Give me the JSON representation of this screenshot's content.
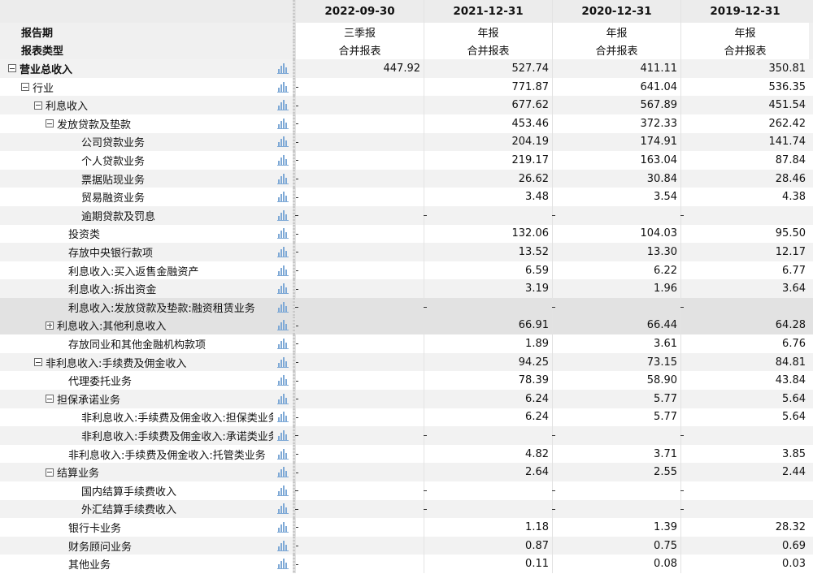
{
  "header": {
    "periods": [
      "2022-09-30",
      "2021-12-31",
      "2020-12-31",
      "2019-12-31"
    ],
    "report_period_label": "报告期",
    "report_type_label": "报表类型",
    "report_periods": [
      "三季报",
      "年报",
      "年报",
      "年报"
    ],
    "report_types": [
      "合并报表",
      "合并报表",
      "合并报表",
      "合并报表"
    ]
  },
  "rows": [
    {
      "label": "营业总收入",
      "indent": 0,
      "toggle": "minus",
      "bold": true,
      "values": [
        "447.92",
        "527.74",
        "411.11",
        "350.81"
      ],
      "dashes": [
        false,
        false,
        false,
        false,
        false
      ]
    },
    {
      "label": "行业",
      "indent": 1,
      "toggle": "minus",
      "values": [
        "",
        "771.87",
        "641.04",
        "536.35"
      ],
      "dashes": [
        true,
        false,
        false,
        false,
        false
      ]
    },
    {
      "label": "利息收入",
      "indent": 2,
      "toggle": "minus",
      "values": [
        "",
        "677.62",
        "567.89",
        "451.54"
      ],
      "dashes": [
        true,
        false,
        false,
        false,
        false
      ]
    },
    {
      "label": "发放贷款及垫款",
      "indent": 3,
      "toggle": "minus",
      "values": [
        "",
        "453.46",
        "372.33",
        "262.42"
      ],
      "dashes": [
        true,
        false,
        false,
        false,
        false
      ]
    },
    {
      "label": "公司贷款业务",
      "indent": 5,
      "values": [
        "",
        "204.19",
        "174.91",
        "141.74"
      ],
      "dashes": [
        true,
        false,
        false,
        false,
        false
      ]
    },
    {
      "label": "个人贷款业务",
      "indent": 5,
      "values": [
        "",
        "219.17",
        "163.04",
        "87.84"
      ],
      "dashes": [
        true,
        false,
        false,
        false,
        false
      ]
    },
    {
      "label": "票据贴现业务",
      "indent": 5,
      "values": [
        "",
        "26.62",
        "30.84",
        "28.46"
      ],
      "dashes": [
        true,
        false,
        false,
        false,
        false
      ]
    },
    {
      "label": "贸易融资业务",
      "indent": 5,
      "values": [
        "",
        "3.48",
        "3.54",
        "4.38"
      ],
      "dashes": [
        true,
        false,
        false,
        false,
        false
      ]
    },
    {
      "label": "逾期贷款及罚息",
      "indent": 5,
      "values": [
        "",
        "",
        "",
        ""
      ],
      "dashes": [
        true,
        true,
        true,
        true,
        true
      ]
    },
    {
      "label": "投资类",
      "indent": 4,
      "values": [
        "",
        "132.06",
        "104.03",
        "95.50"
      ],
      "dashes": [
        true,
        false,
        false,
        false,
        false
      ]
    },
    {
      "label": "存放中央银行款项",
      "indent": 4,
      "values": [
        "",
        "13.52",
        "13.30",
        "12.17"
      ],
      "dashes": [
        true,
        false,
        false,
        false,
        false
      ]
    },
    {
      "label": "利息收入:买入返售金融资产",
      "indent": 4,
      "values": [
        "",
        "6.59",
        "6.22",
        "6.77"
      ],
      "dashes": [
        true,
        false,
        false,
        false,
        false
      ]
    },
    {
      "label": "利息收入:拆出资金",
      "indent": 4,
      "values": [
        "",
        "3.19",
        "1.96",
        "3.64"
      ],
      "dashes": [
        true,
        false,
        false,
        false,
        false
      ]
    },
    {
      "label": "利息收入:发放贷款及垫款:融资租赁业务",
      "indent": 4,
      "values": [
        "",
        "",
        "",
        ""
      ],
      "dashes": [
        true,
        true,
        true,
        true,
        true
      ],
      "dim": true
    },
    {
      "label": "利息收入:其他利息收入",
      "indent": 3,
      "toggle": "plus",
      "values": [
        "",
        "66.91",
        "66.44",
        "64.28"
      ],
      "dashes": [
        true,
        false,
        false,
        false,
        false
      ],
      "dim": true
    },
    {
      "label": "存放同业和其他金融机构款项",
      "indent": 4,
      "values": [
        "",
        "1.89",
        "3.61",
        "6.76"
      ],
      "dashes": [
        true,
        false,
        false,
        false,
        false
      ]
    },
    {
      "label": "非利息收入:手续费及佣金收入",
      "indent": 2,
      "toggle": "minus",
      "values": [
        "",
        "94.25",
        "73.15",
        "84.81"
      ],
      "dashes": [
        true,
        false,
        false,
        false,
        false
      ]
    },
    {
      "label": "代理委托业务",
      "indent": 4,
      "values": [
        "",
        "78.39",
        "58.90",
        "43.84"
      ],
      "dashes": [
        true,
        false,
        false,
        false,
        false
      ]
    },
    {
      "label": "担保承诺业务",
      "indent": 3,
      "toggle": "minus",
      "values": [
        "",
        "6.24",
        "5.77",
        "5.64"
      ],
      "dashes": [
        true,
        false,
        false,
        false,
        false
      ]
    },
    {
      "label": "非利息收入:手续费及佣金收入:担保类业务",
      "indent": 5,
      "values": [
        "",
        "6.24",
        "5.77",
        "5.64"
      ],
      "dashes": [
        true,
        false,
        false,
        false,
        false
      ]
    },
    {
      "label": "非利息收入:手续费及佣金收入:承诺类业务",
      "indent": 5,
      "values": [
        "",
        "",
        "",
        ""
      ],
      "dashes": [
        true,
        true,
        true,
        true,
        true
      ]
    },
    {
      "label": "非利息收入:手续费及佣金收入:托管类业务",
      "indent": 4,
      "values": [
        "",
        "4.82",
        "3.71",
        "3.85"
      ],
      "dashes": [
        true,
        false,
        false,
        false,
        false
      ]
    },
    {
      "label": "结算业务",
      "indent": 3,
      "toggle": "minus",
      "values": [
        "",
        "2.64",
        "2.55",
        "2.44"
      ],
      "dashes": [
        true,
        false,
        false,
        false,
        false
      ]
    },
    {
      "label": "国内结算手续费收入",
      "indent": 5,
      "values": [
        "",
        "",
        "",
        ""
      ],
      "dashes": [
        true,
        true,
        true,
        true,
        true
      ]
    },
    {
      "label": "外汇结算手续费收入",
      "indent": 5,
      "values": [
        "",
        "",
        "",
        ""
      ],
      "dashes": [
        true,
        true,
        true,
        true,
        true
      ]
    },
    {
      "label": "银行卡业务",
      "indent": 4,
      "values": [
        "",
        "1.18",
        "1.39",
        "28.32"
      ],
      "dashes": [
        true,
        false,
        false,
        false,
        false
      ]
    },
    {
      "label": "财务顾问业务",
      "indent": 4,
      "values": [
        "",
        "0.87",
        "0.75",
        "0.69"
      ],
      "dashes": [
        true,
        false,
        false,
        false,
        false
      ]
    },
    {
      "label": "其他业务",
      "indent": 4,
      "values": [
        "",
        "0.11",
        "0.08",
        "0.03"
      ],
      "dashes": [
        true,
        false,
        false,
        false,
        false
      ]
    }
  ]
}
